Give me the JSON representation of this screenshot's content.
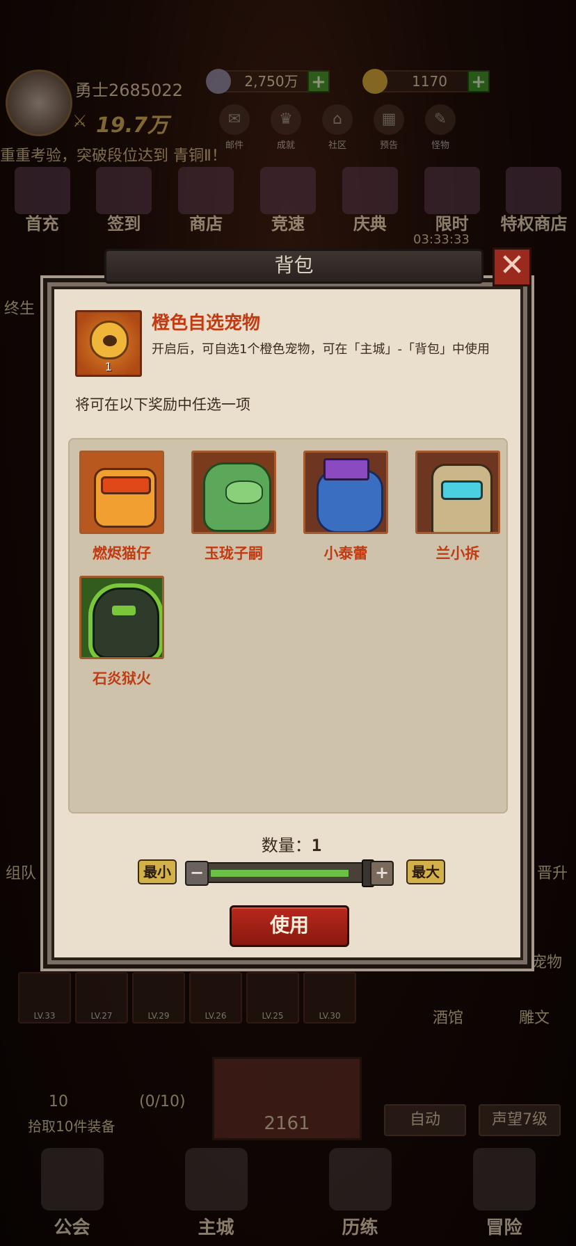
{
  "player": {
    "name": "勇士2685022",
    "power": "19.7万"
  },
  "resources": {
    "silver": "2,750万",
    "gold": "1170",
    "plus_label": "+"
  },
  "top_icons": [
    "邮件",
    "成就",
    "社区",
    "预告",
    "怪物"
  ],
  "marquee": "重重考验，突破段位达到 青铜Ⅱ！",
  "menu": [
    "首充",
    "签到",
    "商店",
    "竞速",
    "庆典",
    "限时",
    "特权商店"
  ],
  "timer": "03:33:33",
  "side_labels": {
    "left_lifetime": "终生",
    "team": "组队",
    "promote": "晋升",
    "tavern": "酒馆",
    "engrave": "雕文",
    "pet": "宠物"
  },
  "gear_levels": [
    "LV.33",
    "LV.27",
    "LV.29",
    "LV.26",
    "LV.25",
    "LV.30"
  ],
  "loot": {
    "count": "10",
    "progress": "(0/10)",
    "task": "拾取10件装备",
    "bag_count": "2161",
    "auto": "自动",
    "reputation": "声望7级"
  },
  "bottom_nav": [
    "公会",
    "主城",
    "历练",
    "冒险"
  ],
  "dialog": {
    "header_title": "背包",
    "close_icon": "✕",
    "item": {
      "icon": "orange-pet-bag-icon",
      "count": "1",
      "title": "橙色自选宠物",
      "description": "开启后，可自选1个橙色宠物，可在「主城」-「背包」中使用"
    },
    "choose_hint": "将可在以下奖励中任选一项",
    "rewards": [
      {
        "name": "燃烬猫仔",
        "icon": "ember-cat-pet-icon"
      },
      {
        "name": "玉珑子嗣",
        "icon": "jade-dragon-pet-icon"
      },
      {
        "name": "小泰蕾",
        "icon": "blue-dino-pet-icon"
      },
      {
        "name": "兰小拆",
        "icon": "robot-pet-icon"
      },
      {
        "name": "石炎狱火",
        "icon": "stone-flame-pet-icon"
      }
    ],
    "quantity_label": "数量：",
    "quantity_value": "1",
    "min_label": "最小",
    "max_label": "最大",
    "minus_label": "−",
    "plus_label": "+",
    "use_label": "使用"
  },
  "colors": {
    "modal_bg": "#e9dfcc",
    "reward_name": "#c23a12",
    "use_button": "#a8221a",
    "slider_fill": "#6cc048",
    "resource_plus": "#3a9a2a"
  }
}
